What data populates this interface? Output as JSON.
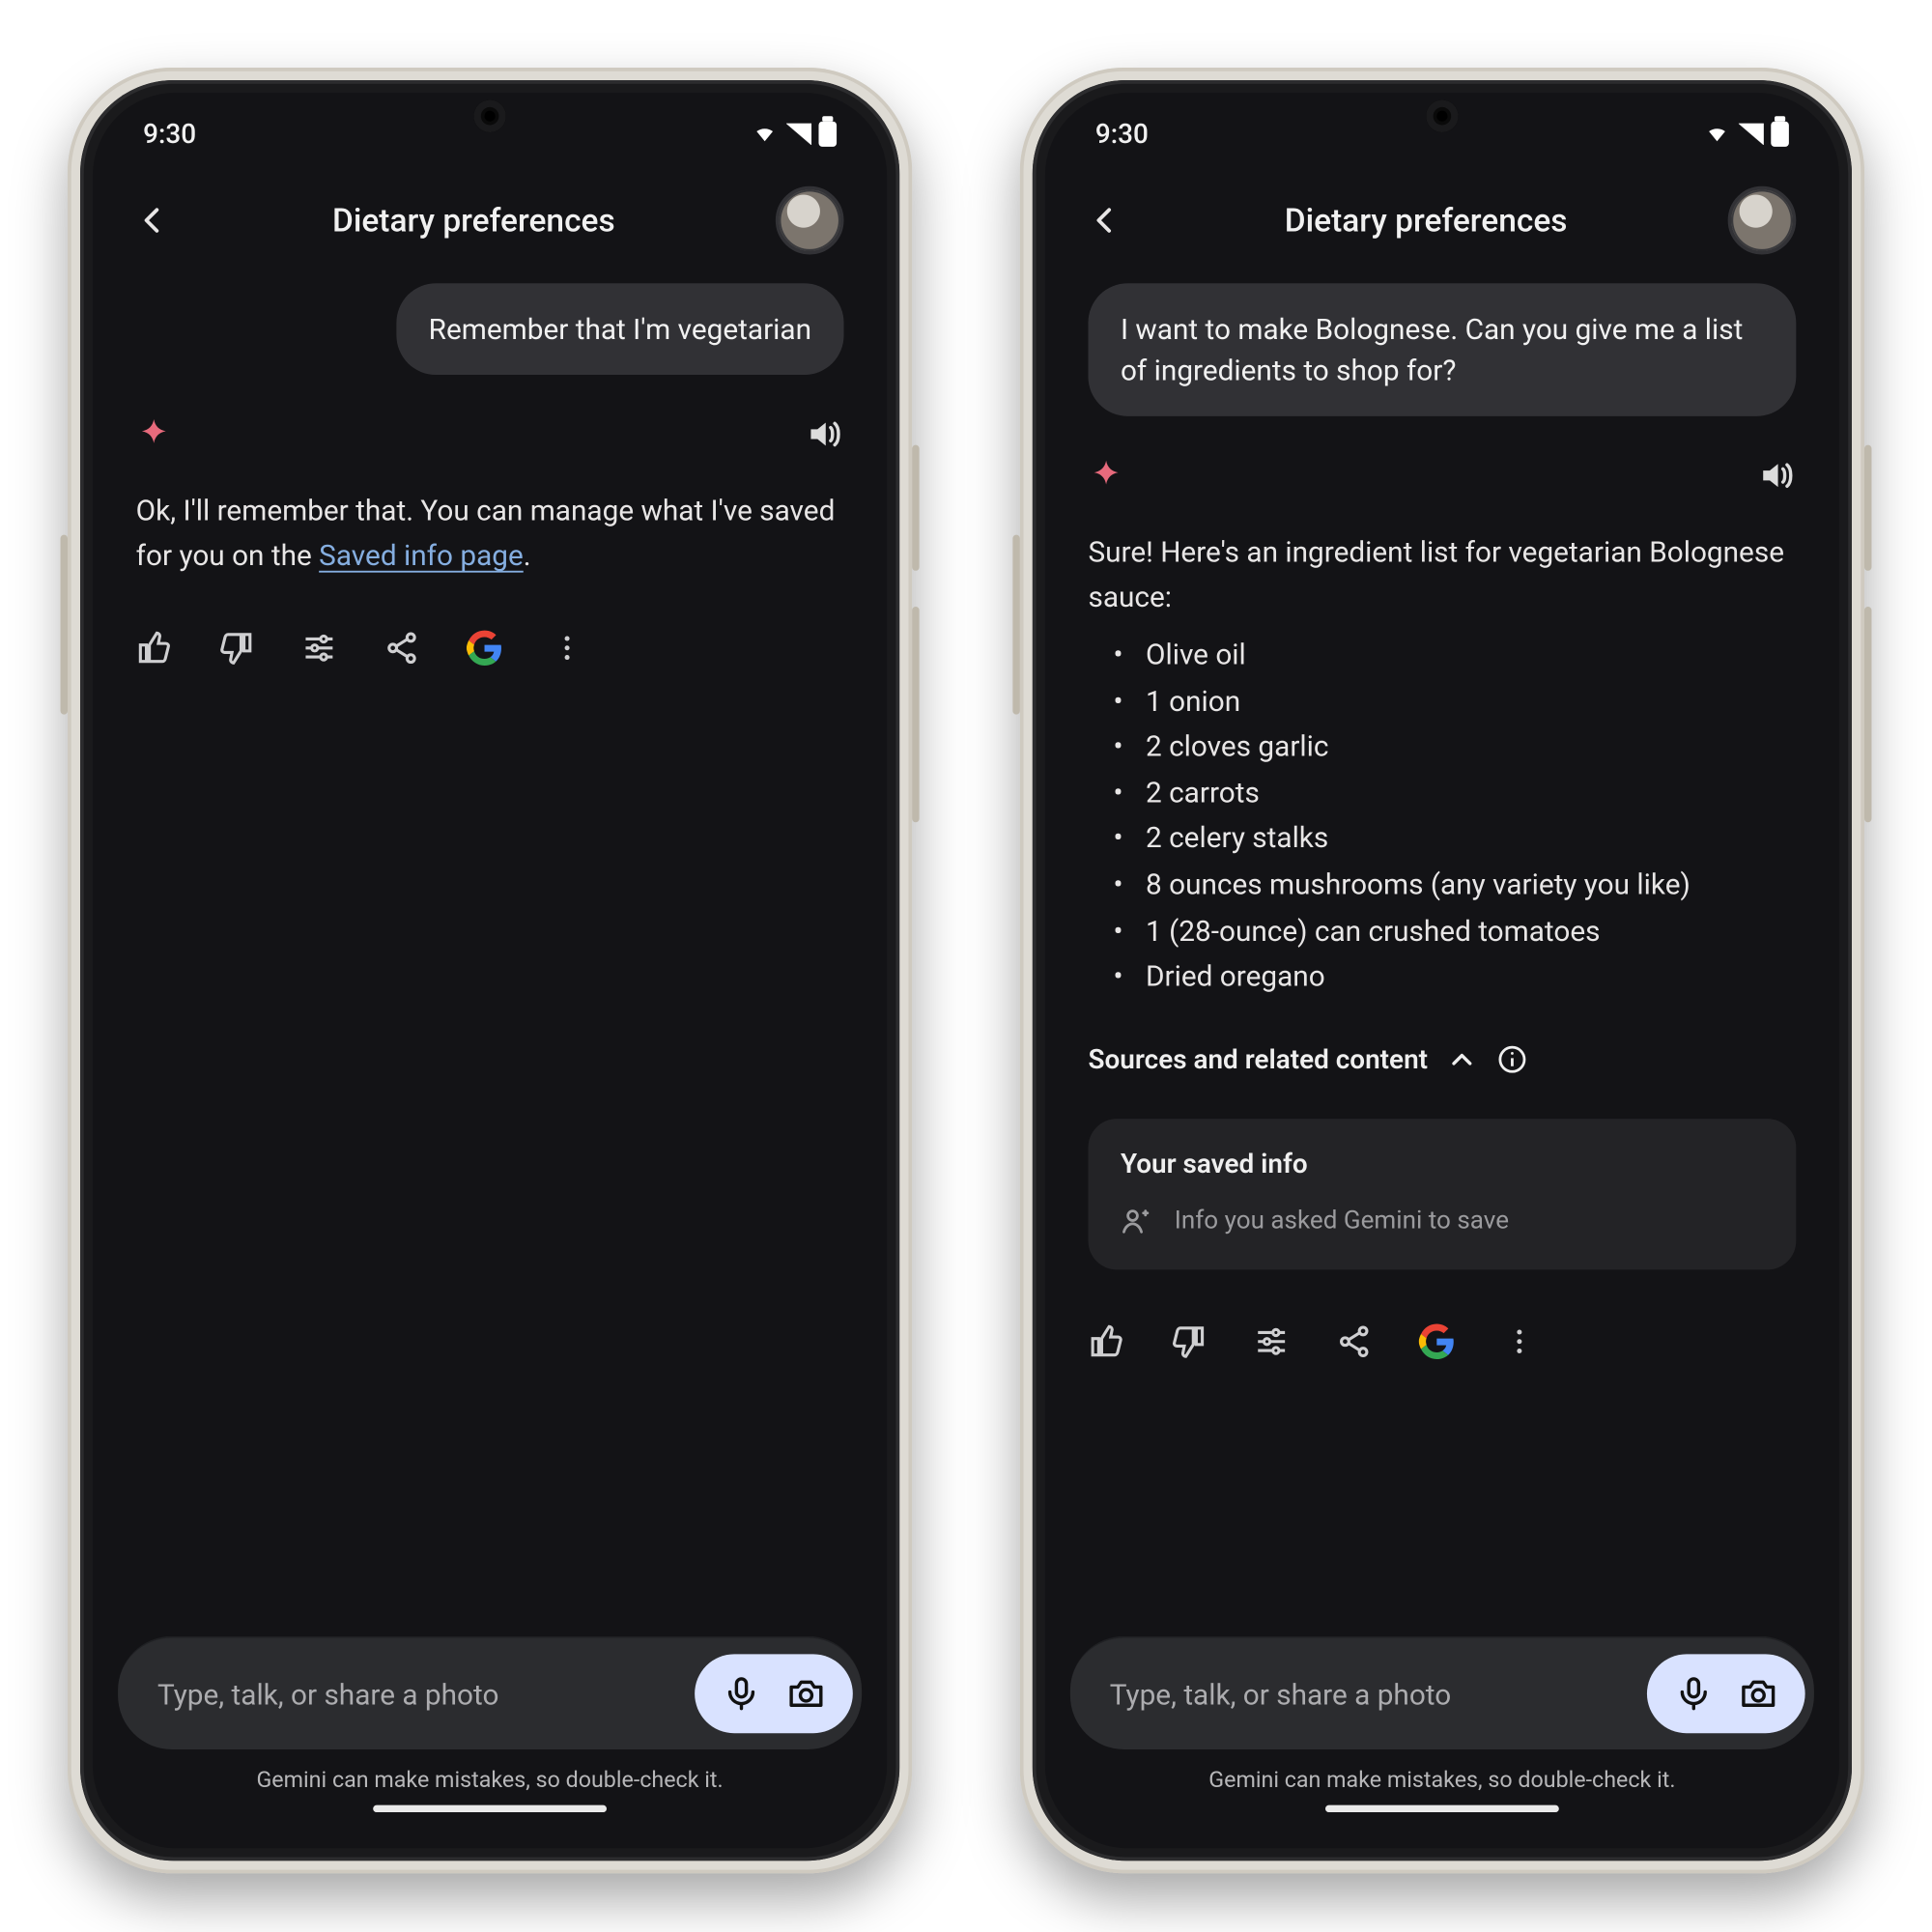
{
  "status": {
    "time": "9:30"
  },
  "header": {
    "title": "Dietary preferences"
  },
  "left": {
    "user_message": "Remember that I'm vegetarian",
    "assistant_pre": "Ok, I'll remember that. You can manage what I've saved for you on the ",
    "assistant_link": "Saved info page",
    "assistant_post": "."
  },
  "right": {
    "user_message": "I want to make Bolognese. Can you give me a list of ingredients to shop for?",
    "assistant_intro": "Sure! Here's an ingredient list for vegetarian Bolognese sauce:",
    "ingredients": [
      "Olive oil",
      "1 onion",
      "2 cloves garlic",
      "2 carrots",
      "2 celery stalks",
      "8 ounces mushrooms (any variety you like)",
      "1 (28-ounce) can crushed tomatoes",
      "Dried oregano"
    ],
    "sources_label": "Sources and related content",
    "saved_card": {
      "title": "Your saved info",
      "subtitle": "Info you asked Gemini to save"
    }
  },
  "input": {
    "placeholder": "Type, talk, or share a photo"
  },
  "disclaimer": "Gemini can make mistakes, so double-check it."
}
